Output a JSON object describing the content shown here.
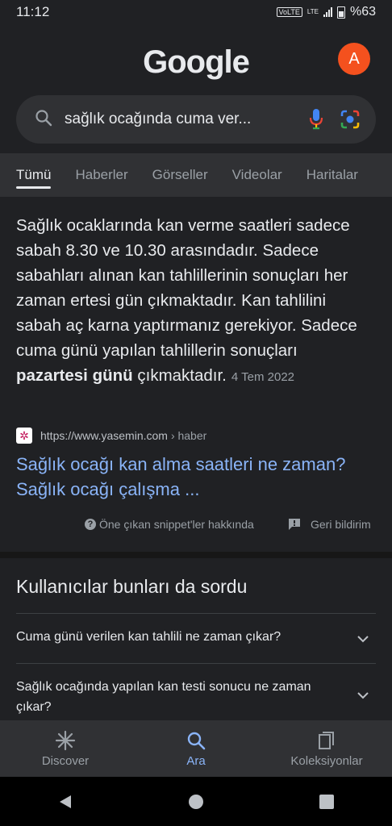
{
  "status_bar": {
    "time": "11:12",
    "network": "VoLTE",
    "lte": "LTE",
    "battery": "%63"
  },
  "header": {
    "logo": "Google",
    "avatar_letter": "A"
  },
  "search": {
    "query": "sağlık ocağında cuma ver..."
  },
  "tabs": [
    "Tümü",
    "Haberler",
    "Görseller",
    "Videolar",
    "Haritalar"
  ],
  "snippet": {
    "text_before": "Sağlık ocaklarında kan verme saatleri sadece sabah 8.30 ve 10.30 arasındadır. Sadece sabahları alınan kan tahlillerinin sonuçları her zaman ertesi gün çıkmaktadır. Kan tahlilini sabah aç karna yaptırmanız gerekiyor. Sadece cuma günü yapılan tahlillerin sonuçları ",
    "bold": "pazartesi günü",
    "text_after": " çıkmaktadır.",
    "date": "4 Tem 2022",
    "source_url": "https://www.yasemin.com",
    "source_path": "› haber",
    "link_title": "Sağlık ocağı kan alma saatleri ne zaman? Sağlık ocağı çalışma ...",
    "about_label": "Öne çıkan snippet'ler hakkında",
    "feedback_label": "Geri bildirim"
  },
  "paa": {
    "title": "Kullanıcılar bunları da sordu",
    "questions": [
      "Cuma günü verilen kan tahlili ne zaman çıkar?",
      "Sağlık ocağında yapılan kan testi sonucu ne zaman çıkar?"
    ]
  },
  "bottom_nav": {
    "discover": "Discover",
    "search": "Ara",
    "collections": "Koleksiyonlar"
  },
  "colors": {
    "accent": "#8ab4f8",
    "avatar": "#f4511e",
    "background": "#202124"
  }
}
